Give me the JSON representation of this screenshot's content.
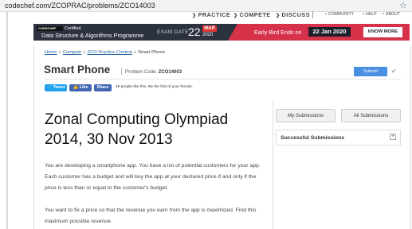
{
  "browser": {
    "url": "codechef.com/ZCOPRAC/problems/ZCO14003",
    "bookmark_icon": "star-icon"
  },
  "nav": {
    "items": [
      "PRACTICE",
      "COMPETE",
      "DISCUSS"
    ],
    "secondary": [
      "COMMUNITY",
      "HELP",
      "ABOUT"
    ],
    "chevron_icon": "chevron-right-icon"
  },
  "banner": {
    "logo": "CODECHEF",
    "certified": "Certified",
    "programme": "Data Structure & Algorithms Programme",
    "exam_date_label": "EXAM DATE",
    "exam_day": "22",
    "exam_month": "MAR",
    "exam_year": "2020",
    "early_bird": "Early Bird Ends on",
    "early_bird_date": "22 Jan 2020",
    "cta": "KNOW MORE",
    "accent_color": "#d6324a",
    "bg_color": "#2d3240"
  },
  "breadcrumb": [
    {
      "label": "Home",
      "link": true
    },
    {
      "label": "Compete",
      "link": true
    },
    {
      "label": "ZCO Practice Contest",
      "link": true
    },
    {
      "label": "Smart Phone",
      "link": false
    }
  ],
  "breadcrumb_separator": "»",
  "problem": {
    "title": "Smart Phone",
    "code_label": "Problem Code:",
    "code": "ZCO14003",
    "submit_label": "Submit",
    "check_icon": "checkmark-icon",
    "heading_line1": "Zonal Computing Olympiad",
    "heading_line2": "2014, 30 Nov 2013",
    "paragraph1": "You are developing a smartphone app. You have a list of potential customers for your app. Each customer has a budget and will buy the app at your declared price if and only if the price is less than or equal to the customer's budget.",
    "paragraph2": "You want to fix a price so that the revenue you earn from the app is maximized. Find this maximum possible revenue."
  },
  "social": {
    "tweet": "Tweet",
    "like": "Like",
    "share": "Share",
    "likes_text": "46 people like this. Be the first of your friends.",
    "twitter_color": "#1da1f2",
    "facebook_color": "#4267b2"
  },
  "sidebar": {
    "my_submissions": "My Submissions",
    "all_submissions": "All Submissions",
    "successful_submissions": "Successful Submissions",
    "expand_symbol": "+",
    "expand_icon": "plus-icon"
  }
}
